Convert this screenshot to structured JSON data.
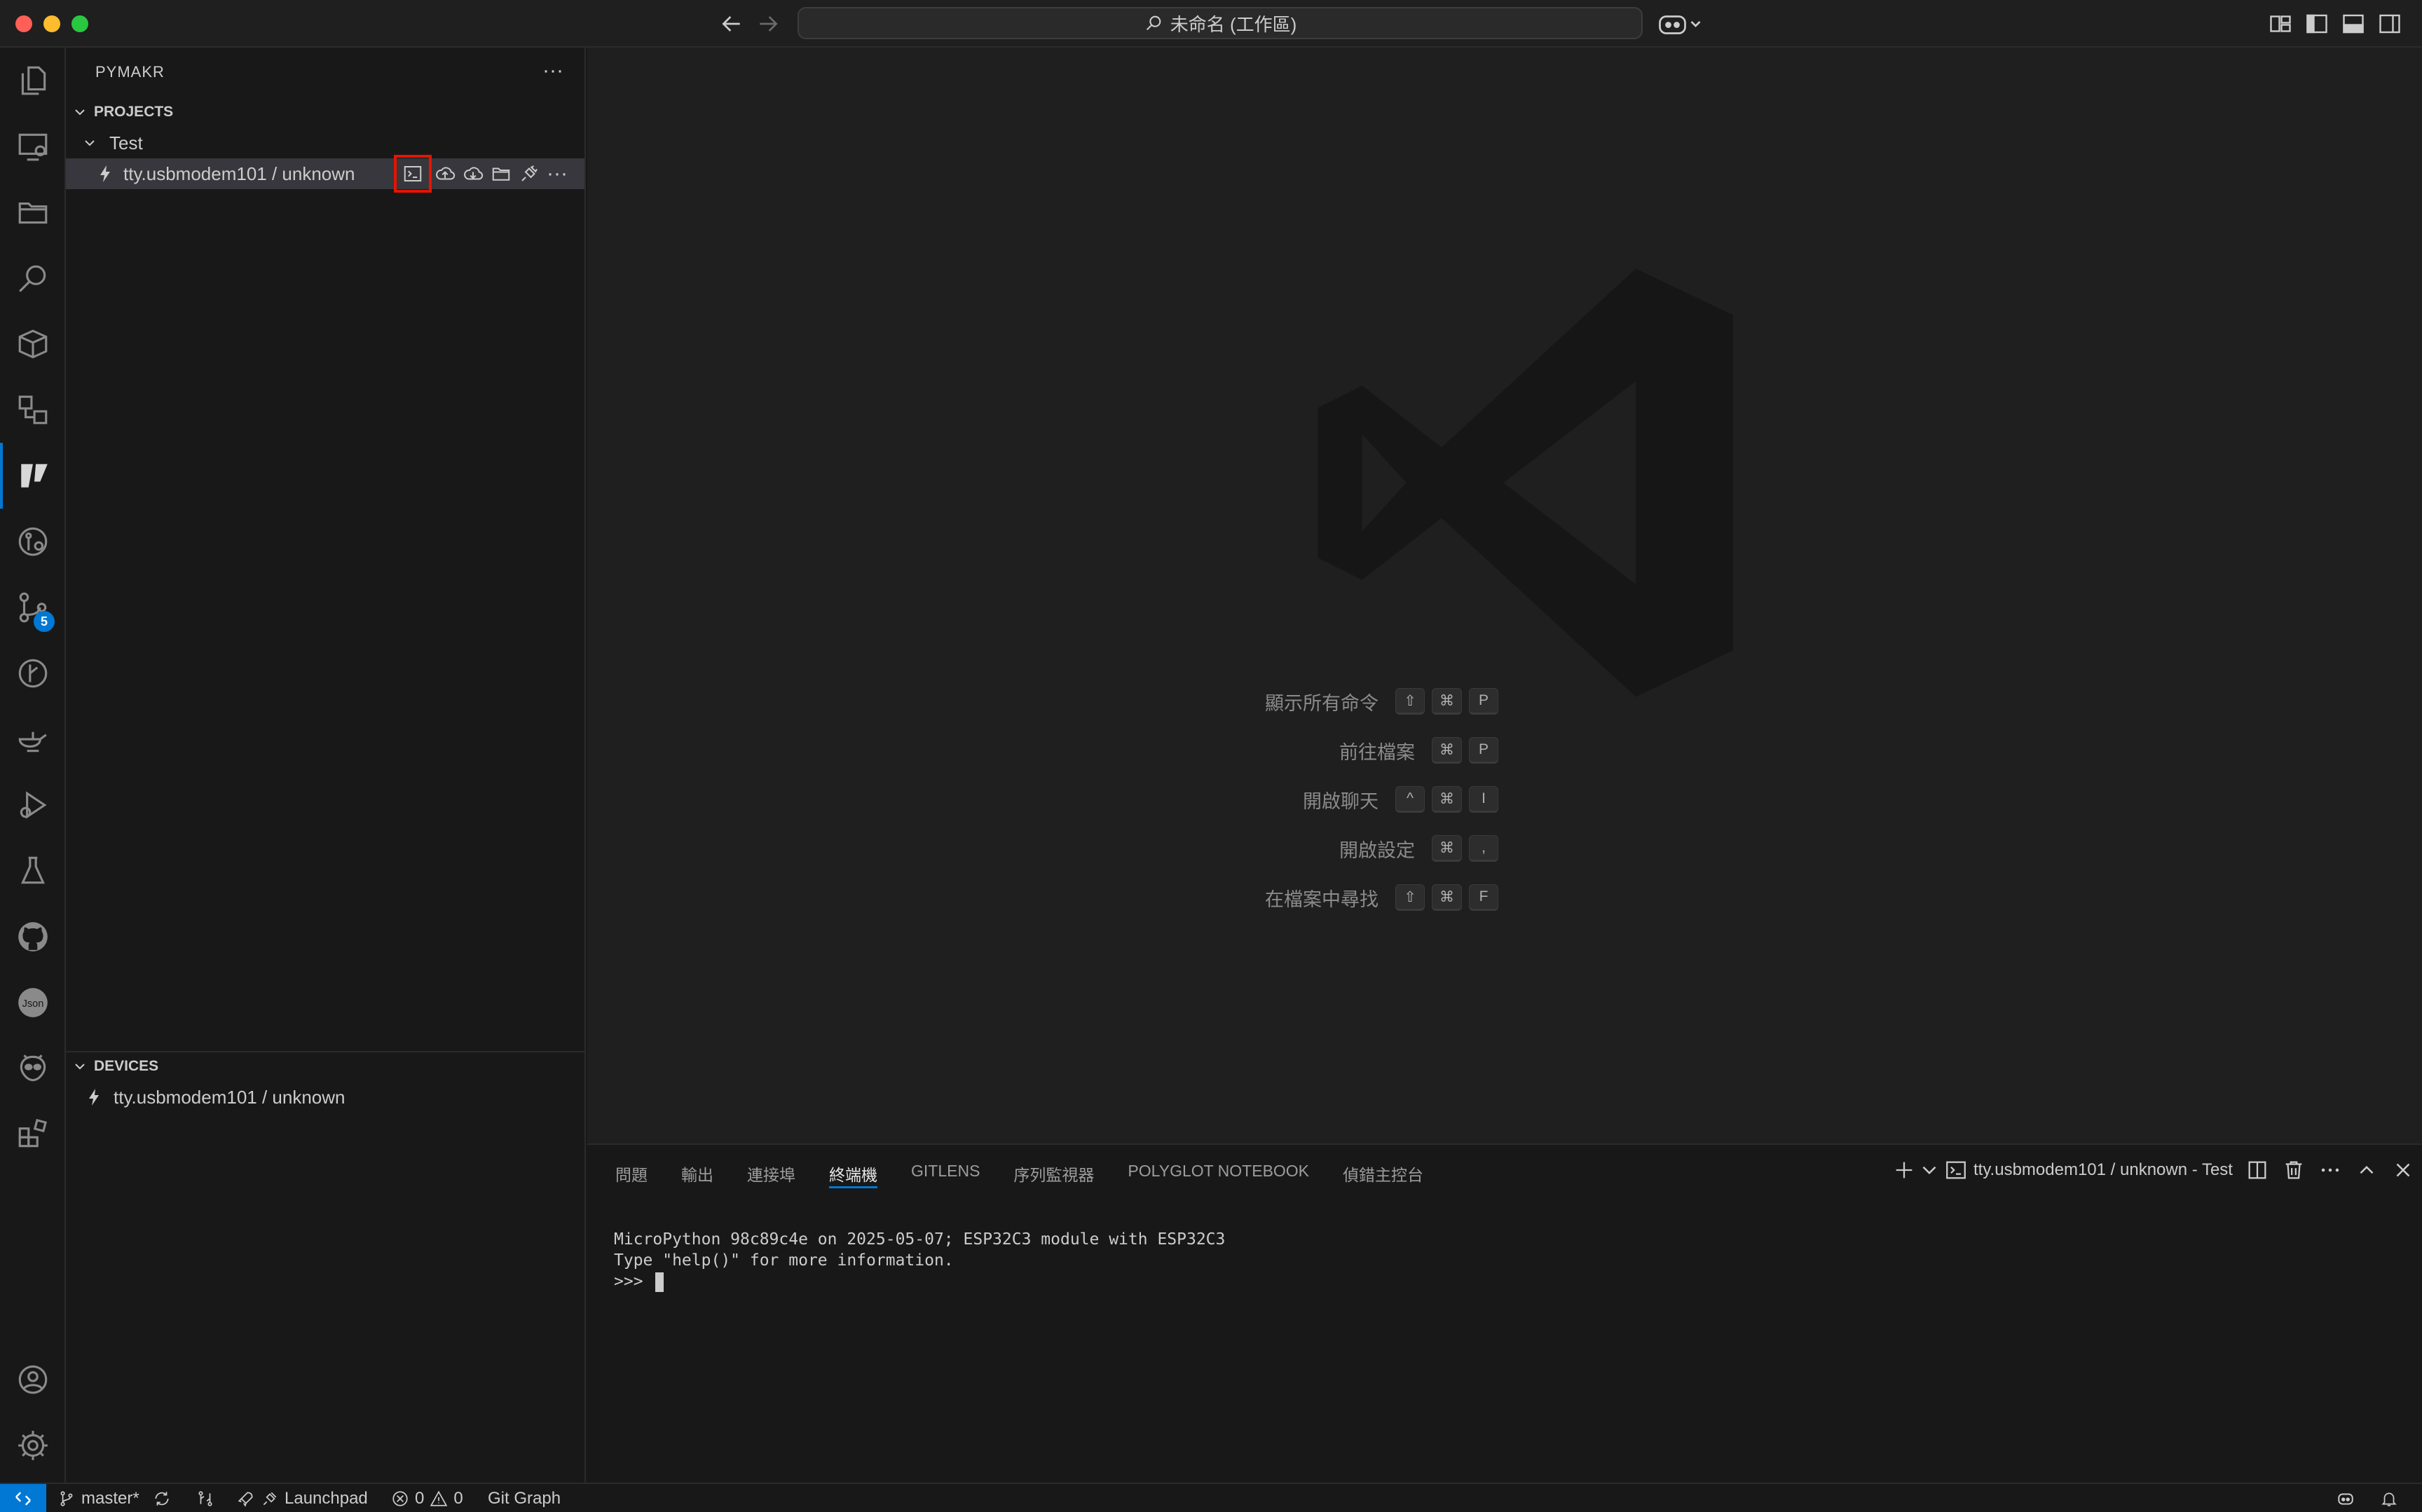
{
  "window": {
    "title": "未命名 (工作區)"
  },
  "sidebar": {
    "title": "PYMAKR",
    "more": "···",
    "projects_header": "PROJECTS",
    "project_name": "Test",
    "device_row_label": "tty.usbmodem101 / unknown",
    "device_row_more": "···",
    "devices_header": "DEVICES",
    "device_label": "tty.usbmodem101 / unknown"
  },
  "activity_bar": {
    "items": [
      "explorer-icon",
      "remote-explorer-icon",
      "folders-icon",
      "search-icon",
      "packages-icon",
      "extensions-tree-icon",
      "pymakr-icon",
      "git-lens-icon",
      "source-control-icon",
      "git-graph-icon",
      "genie-icon",
      "run-debug-icon",
      "testing-icon",
      "github-icon",
      "json-icon",
      "alien-icon",
      "extensions-icon"
    ],
    "source_control_badge": "5"
  },
  "editor": {
    "shortcuts": [
      {
        "label": "顯示所有命令",
        "keys": [
          "⇧",
          "⌘",
          "P"
        ]
      },
      {
        "label": "前往檔案",
        "keys": [
          "⌘",
          "P"
        ]
      },
      {
        "label": "開啟聊天",
        "keys": [
          "^",
          "⌘",
          "I"
        ]
      },
      {
        "label": "開啟設定",
        "keys": [
          "⌘",
          ","
        ]
      },
      {
        "label": "在檔案中尋找",
        "keys": [
          "⇧",
          "⌘",
          "F"
        ]
      }
    ]
  },
  "panel": {
    "tabs": [
      "問題",
      "輸出",
      "連接埠",
      "終端機",
      "GITLENS",
      "序列監視器",
      "POLYGLOT NOTEBOOK",
      "偵錯主控台"
    ],
    "active_tab": "終端機",
    "terminal_name": "tty.usbmodem101 / unknown - Test",
    "terminal_lines": [
      "MicroPython 98c89c4e on 2025-05-07; ESP32C3 module with ESP32C3",
      "Type \"help()\" for more information.",
      ">>> "
    ]
  },
  "status_bar": {
    "branch": "master*",
    "launchpad": "Launchpad",
    "errors": "0",
    "warnings": "0",
    "git_graph": "Git Graph"
  },
  "colors": {
    "accent": "#0078d4",
    "highlight_box": "#e51400",
    "background": "#181818",
    "editor_background": "#1f1f1f"
  }
}
